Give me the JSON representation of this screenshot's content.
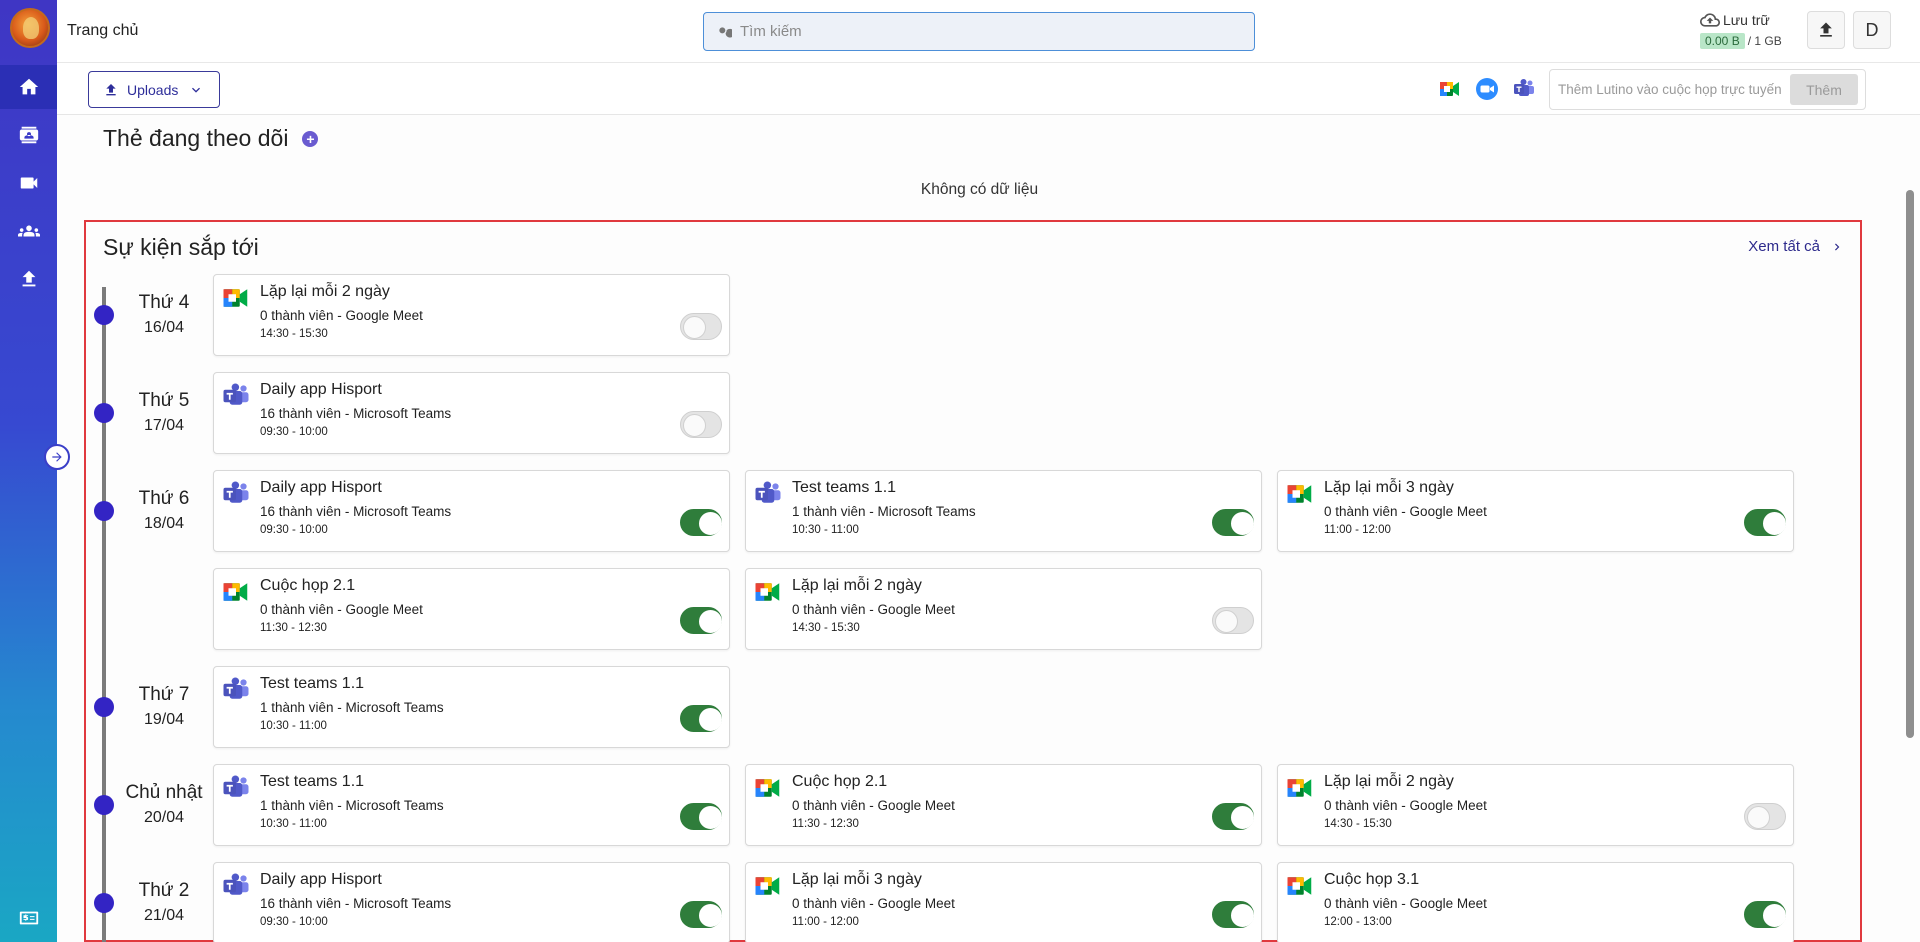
{
  "header": {
    "home_title": "Trang chủ",
    "search_placeholder": "Tìm kiếm",
    "storage_label": "Lưu trữ",
    "storage_used": "0.00 B",
    "storage_total": "/ 1 GB",
    "avatar_letter": "D"
  },
  "toolbar": {
    "uploads_label": "Uploads",
    "lutino_placeholder": "Thêm Lutino vào cuộc họp trực tuyến",
    "lutino_button": "Thêm"
  },
  "followed": {
    "title": "Thẻ đang theo dõi",
    "empty_text": "Không có dữ liệu"
  },
  "events": {
    "title": "Sự kiện sắp tới",
    "see_all": "Xem tất cả",
    "days": [
      {
        "name": "Thứ 4",
        "date": "16/04",
        "rows": [
          [
            {
              "title": "Lặp lại mỗi 2 ngày",
              "sub": "0 thành viên - Google Meet",
              "time": "14:30 - 15:30",
              "app": "meet",
              "on": false
            }
          ]
        ]
      },
      {
        "name": "Thứ 5",
        "date": "17/04",
        "rows": [
          [
            {
              "title": "Daily app Hisport",
              "sub": "16 thành viên - Microsoft Teams",
              "time": "09:30 - 10:00",
              "app": "teams",
              "on": false
            }
          ]
        ]
      },
      {
        "name": "Thứ 6",
        "date": "18/04",
        "rows": [
          [
            {
              "title": "Daily app Hisport",
              "sub": "16 thành viên - Microsoft Teams",
              "time": "09:30 - 10:00",
              "app": "teams",
              "on": true
            },
            {
              "title": "Test teams 1.1",
              "sub": "1 thành viên - Microsoft Teams",
              "time": "10:30 - 11:00",
              "app": "teams",
              "on": true
            },
            {
              "title": "Lặp lại mỗi 3 ngày",
              "sub": "0 thành viên - Google Meet",
              "time": "11:00 - 12:00",
              "app": "meet",
              "on": true
            }
          ],
          [
            {
              "title": "Cuộc họp 2.1",
              "sub": "0 thành viên - Google Meet",
              "time": "11:30 - 12:30",
              "app": "meet",
              "on": true
            },
            {
              "title": "Lặp lại mỗi 2 ngày",
              "sub": "0 thành viên - Google Meet",
              "time": "14:30 - 15:30",
              "app": "meet",
              "on": false
            }
          ]
        ]
      },
      {
        "name": "Thứ 7",
        "date": "19/04",
        "rows": [
          [
            {
              "title": "Test teams 1.1",
              "sub": "1 thành viên - Microsoft Teams",
              "time": "10:30 - 11:00",
              "app": "teams",
              "on": true
            }
          ]
        ]
      },
      {
        "name": "Chủ nhật",
        "date": "20/04",
        "rows": [
          [
            {
              "title": "Test teams 1.1",
              "sub": "1 thành viên - Microsoft Teams",
              "time": "10:30 - 11:00",
              "app": "teams",
              "on": true
            },
            {
              "title": "Cuộc họp 2.1",
              "sub": "0 thành viên - Google Meet",
              "time": "11:30 - 12:30",
              "app": "meet",
              "on": true
            },
            {
              "title": "Lặp lại mỗi 2 ngày",
              "sub": "0 thành viên - Google Meet",
              "time": "14:30 - 15:30",
              "app": "meet",
              "on": false
            }
          ]
        ]
      },
      {
        "name": "Thứ 2",
        "date": "21/04",
        "rows": [
          [
            {
              "title": "Daily app Hisport",
              "sub": "16 thành viên - Microsoft Teams",
              "time": "09:30 - 10:00",
              "app": "teams",
              "on": true
            },
            {
              "title": "Lặp lại mỗi 3 ngày",
              "sub": "0 thành viên - Google Meet",
              "time": "11:00 - 12:00",
              "app": "meet",
              "on": true
            },
            {
              "title": "Cuộc họp 3.1",
              "sub": "0 thành viên - Google Meet",
              "time": "12:00 - 13:00",
              "app": "meet",
              "on": true
            }
          ]
        ]
      }
    ]
  },
  "icons": {
    "sidebar": [
      "home-icon",
      "contacts-icon",
      "video-icon",
      "groups-icon",
      "upload-icon",
      "wallet-icon"
    ],
    "meeting_apps": [
      "google-meet-icon",
      "zoom-icon",
      "microsoft-teams-icon"
    ]
  },
  "colors": {
    "accent": "#3324c4",
    "toggle_on": "#2f7d3b",
    "highlight_border": "#e0393e"
  }
}
